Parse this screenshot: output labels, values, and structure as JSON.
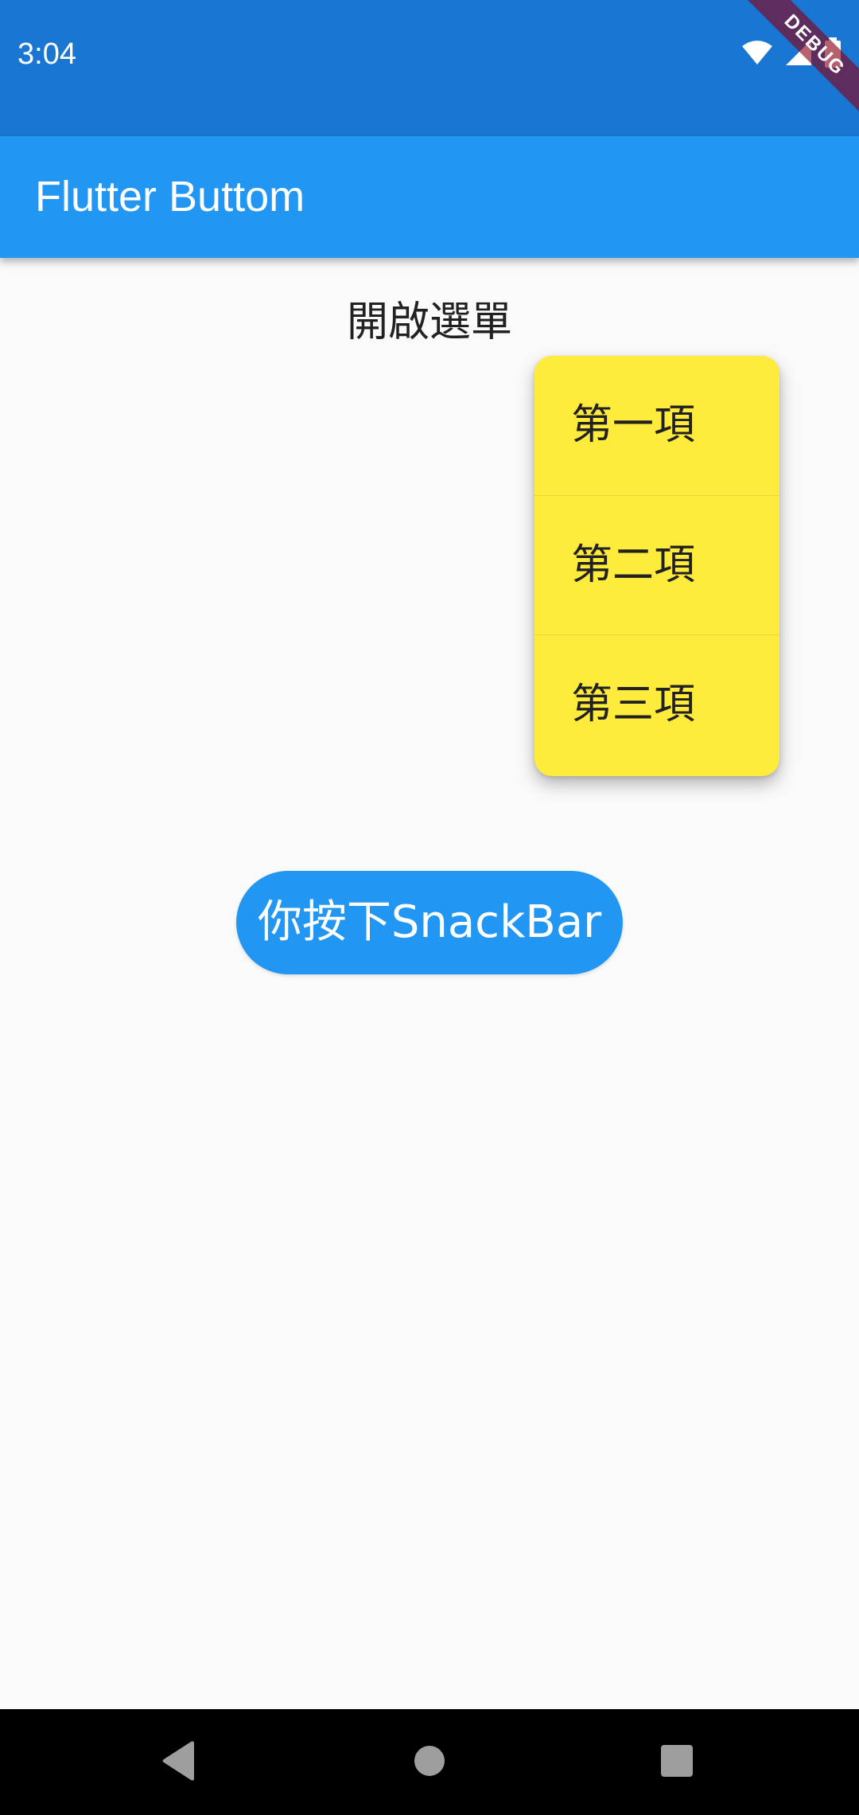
{
  "status_bar": {
    "time": "3:04",
    "icons": [
      "wifi-icon",
      "signal-icon",
      "battery-icon"
    ],
    "debug_label": "DEBUG"
  },
  "app_bar": {
    "title": "Flutter Buttom"
  },
  "main": {
    "open_menu_label": "開啟選單",
    "popup_menu": {
      "items": [
        {
          "label": "第一項"
        },
        {
          "label": "第二項"
        },
        {
          "label": "第三項"
        }
      ]
    },
    "snackbar_button_label": "你按下SnackBar"
  },
  "nav_bar": {
    "icons": [
      "back-icon",
      "home-icon",
      "recents-icon"
    ]
  },
  "colors": {
    "status_bar": "#1976d2",
    "app_bar": "#2196f3",
    "menu_background": "#ffeb3b",
    "button": "#2196f3",
    "background": "#fafafa"
  }
}
